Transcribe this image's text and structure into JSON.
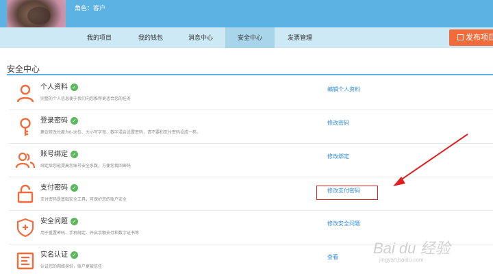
{
  "header": {
    "role_text": "角色：客户",
    "publish_label": "发布项目"
  },
  "nav": {
    "items": [
      {
        "label": "我的项目"
      },
      {
        "label": "我的钱包"
      },
      {
        "label": "消息中心"
      },
      {
        "label": "安全中心",
        "active": true
      },
      {
        "label": "发票管理"
      }
    ]
  },
  "section": {
    "title": "安全中心"
  },
  "rows": [
    {
      "title": "个人资料",
      "desc": "完整的个人信息便于我们向您推荐更适合您的任务",
      "action": "编辑个人资料",
      "icon": "user-icon"
    },
    {
      "title": "登录密码",
      "desc": "建议修改长度为6-16位、大小写字母、数字混合设置密码，请不要和支付密码设成一样。",
      "action": "修改密码",
      "icon": "key-icon"
    },
    {
      "title": "账号绑定",
      "desc": "绑定后您能提高您账号安全系数，方便您找回密码",
      "action": "修改绑定",
      "icon": "users-icon"
    },
    {
      "title": "支付密码",
      "desc": "支付密码是基础安全工具，可保护您的账户安全",
      "action": "修改支付密码",
      "icon": "lock-icon"
    },
    {
      "title": "安全问题",
      "desc": "用于重置密码、手机绑定、开启余额支付和数字证书等",
      "action": "修改安全问题",
      "icon": "shield-icon"
    },
    {
      "title": "实名认证",
      "desc": "认证您的网络身份，账户更被信任",
      "action": "查看",
      "icon": "id-card-icon"
    }
  ],
  "colors": {
    "accent": "#5bb2e3",
    "icon": "#f26b3a",
    "link": "#2e8bd6",
    "highlight": "#e02020"
  },
  "watermark": {
    "text": "Bai du 经验",
    "url": "jingyan.baidu.com"
  }
}
